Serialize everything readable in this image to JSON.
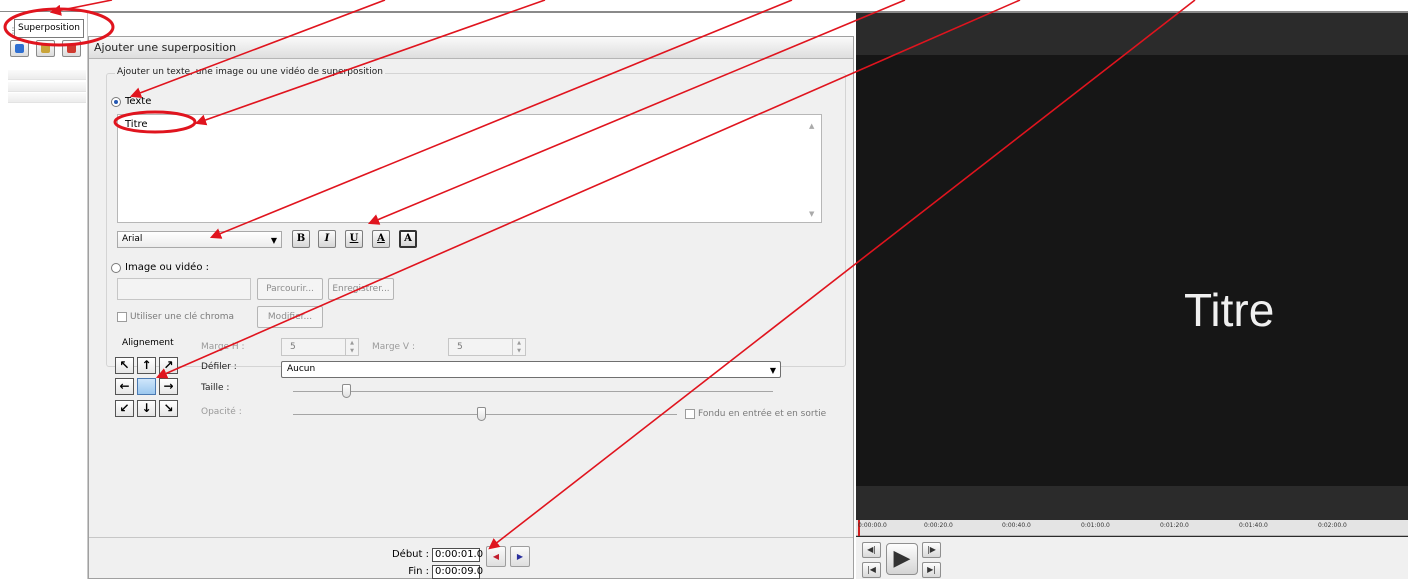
{
  "tab": {
    "label": "Superposition"
  },
  "panel": {
    "header": "Ajouter une superposition",
    "group_legend": "Ajouter un texte, une image ou une vidéo de superposition",
    "text_option": "Texte",
    "text_value": "Titre",
    "font": "Arial",
    "format_buttons": [
      "B",
      "I",
      "U",
      "A",
      "A"
    ],
    "image_option": "Image ou vidéo :",
    "browse_label": "Parcourir...",
    "save_label": "Enregistrer...",
    "chroma_label": "Utiliser une clé chroma",
    "modify_label": "Modifier..."
  },
  "settings": {
    "alignment_label": "Alignement",
    "margin_h_label": "Marge H :",
    "margin_h_value": "5",
    "margin_v_label": "Marge V :",
    "margin_v_value": "5",
    "scroll_label": "Défiler :",
    "scroll_value": "Aucun",
    "size_label": "Taille :",
    "size_level": 0.11,
    "opacity_label": "Opacité :",
    "opacity_level": 0.49,
    "fade_label": "Fondu en entrée et en sortie"
  },
  "alignment_arrows": [
    "↖",
    "↑",
    "↗",
    "←",
    "",
    "→",
    "↙",
    "↓",
    "↘"
  ],
  "timing": {
    "start_label": "Début :",
    "start_value": "0:00:01.0",
    "end_label": "Fin :",
    "end_value": "0:00:09.0"
  },
  "preview": {
    "overlay_text": "Titre",
    "timeline_ticks": [
      "0:00:00.0",
      "0:00:20.0",
      "0:00:40.0",
      "0:01:00.0",
      "0:01:20.0",
      "0:01:40.0",
      "0:02:00.0"
    ]
  },
  "colors": {
    "annotation": "#e0141e",
    "radio_selected": "#2458b3",
    "preview_bg": "#161616"
  }
}
